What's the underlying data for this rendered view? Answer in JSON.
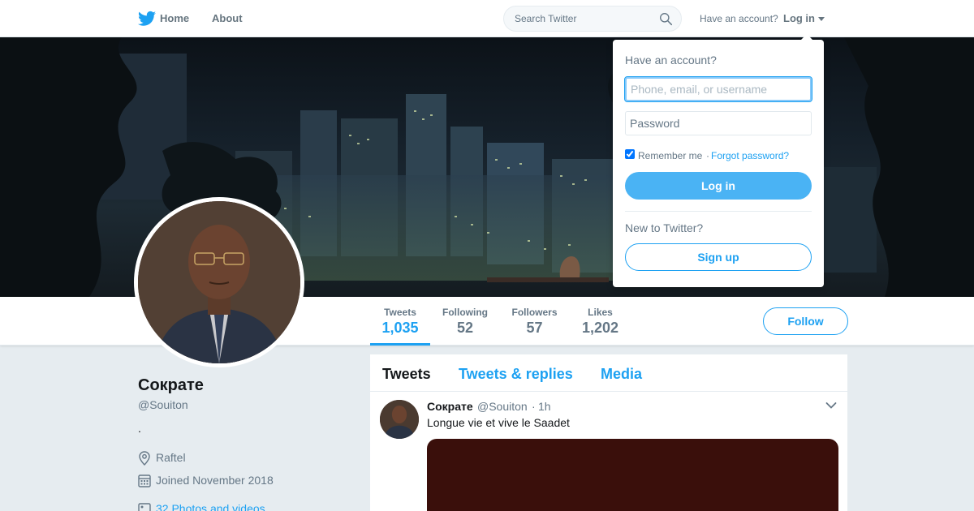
{
  "topbar": {
    "nav_home": "Home",
    "nav_about": "About",
    "search_placeholder": "Search Twitter",
    "have_account": "Have an account?",
    "login_label": "Log in"
  },
  "profile_nav": {
    "stats": [
      {
        "label": "Tweets",
        "value": "1,035"
      },
      {
        "label": "Following",
        "value": "52"
      },
      {
        "label": "Followers",
        "value": "57"
      },
      {
        "label": "Likes",
        "value": "1,202"
      }
    ],
    "follow_label": "Follow"
  },
  "profile": {
    "name": "Сократе",
    "handle": "@Souiton",
    "bio": ".",
    "location": "Raftel",
    "joined": "Joined November 2018",
    "photos": "32 Photos and videos"
  },
  "timeline": {
    "tabs": [
      "Tweets",
      "Tweets & replies",
      "Media"
    ],
    "tweet": {
      "name": "Сократе",
      "handle": "@Souiton",
      "separator": "·",
      "time": "1h",
      "text": "Longue vie et vive le Saadet"
    }
  },
  "login_dropdown": {
    "title": "Have an account?",
    "username_placeholder": "Phone, email, or username",
    "password_placeholder": "Password",
    "remember_label": "Remember me",
    "separator": "·",
    "forgot_label": "Forgot password?",
    "login_button": "Log in",
    "new_label": "New to Twitter?",
    "signup_button": "Sign up"
  },
  "colors": {
    "accent": "#1da1f2",
    "login_button": "#4ab3f4",
    "background": "#e6ecf0",
    "media_placeholder": "#3a0f0b"
  }
}
